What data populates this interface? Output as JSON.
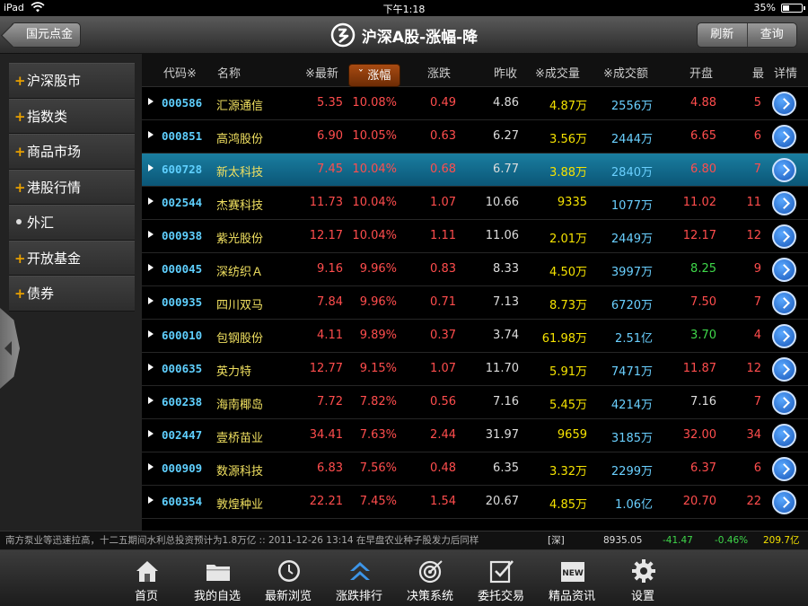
{
  "status": {
    "device": "iPad",
    "time": "下午1:18",
    "battery": "35%"
  },
  "header": {
    "back_label": "国元点金",
    "title": "沪深A股-涨幅-降",
    "refresh_label": "刷新",
    "query_label": "查询"
  },
  "sidebar": {
    "items": [
      {
        "label": "沪深股市",
        "marker": "+"
      },
      {
        "label": "指数类",
        "marker": "+"
      },
      {
        "label": "商品市场",
        "marker": "+"
      },
      {
        "label": "港股行情",
        "marker": "+"
      },
      {
        "label": "外汇",
        "marker": "•"
      },
      {
        "label": "开放基金",
        "marker": "+"
      },
      {
        "label": "债券",
        "marker": "+"
      }
    ]
  },
  "table": {
    "headers": {
      "code": "代码※",
      "name": "名称",
      "price": "※最新",
      "pct": "涨幅",
      "chg": "涨跌",
      "prev": "昨收",
      "vol": "※成交量",
      "amt": "※成交额",
      "open": "开盘",
      "high": "最",
      "detail": "详情"
    },
    "rows": [
      {
        "code": "000586",
        "name": "汇源通信",
        "price": "5.35",
        "pct": "10.08%",
        "chg": "0.49",
        "prev": "4.86",
        "vol": "4.87万",
        "amt": "2556万",
        "open": "4.88",
        "open_color": "red",
        "high": "5"
      },
      {
        "code": "000851",
        "name": "高鸿股份",
        "price": "6.90",
        "pct": "10.05%",
        "chg": "0.63",
        "prev": "6.27",
        "vol": "3.56万",
        "amt": "2444万",
        "open": "6.65",
        "open_color": "red",
        "high": "6"
      },
      {
        "code": "600728",
        "name": "新太科技",
        "price": "7.45",
        "pct": "10.04%",
        "chg": "0.68",
        "prev": "6.77",
        "vol": "3.88万",
        "amt": "2840万",
        "open": "6.80",
        "open_color": "red",
        "high": "7"
      },
      {
        "code": "002544",
        "name": "杰赛科技",
        "price": "11.73",
        "pct": "10.04%",
        "chg": "1.07",
        "prev": "10.66",
        "vol": "9335",
        "amt": "1077万",
        "open": "11.02",
        "open_color": "red",
        "high": "11"
      },
      {
        "code": "000938",
        "name": "紫光股份",
        "price": "12.17",
        "pct": "10.04%",
        "chg": "1.11",
        "prev": "11.06",
        "vol": "2.01万",
        "amt": "2449万",
        "open": "12.17",
        "open_color": "red",
        "high": "12"
      },
      {
        "code": "000045",
        "name": "深纺织Ａ",
        "price": "9.16",
        "pct": "9.96%",
        "chg": "0.83",
        "prev": "8.33",
        "vol": "4.50万",
        "amt": "3997万",
        "open": "8.25",
        "open_color": "green",
        "high": "9"
      },
      {
        "code": "000935",
        "name": "四川双马",
        "price": "7.84",
        "pct": "9.96%",
        "chg": "0.71",
        "prev": "7.13",
        "vol": "8.73万",
        "amt": "6720万",
        "open": "7.50",
        "open_color": "red",
        "high": "7"
      },
      {
        "code": "600010",
        "name": "包钢股份",
        "price": "4.11",
        "pct": "9.89%",
        "chg": "0.37",
        "prev": "3.74",
        "vol": "61.98万",
        "amt": "2.51亿",
        "open": "3.70",
        "open_color": "green",
        "high": "4"
      },
      {
        "code": "000635",
        "name": "英力特",
        "price": "12.77",
        "pct": "9.15%",
        "chg": "1.07",
        "prev": "11.70",
        "vol": "5.91万",
        "amt": "7471万",
        "open": "11.87",
        "open_color": "red",
        "high": "12"
      },
      {
        "code": "600238",
        "name": "海南椰岛",
        "price": "7.72",
        "pct": "7.82%",
        "chg": "0.56",
        "prev": "7.16",
        "vol": "5.45万",
        "amt": "4214万",
        "open": "7.16",
        "open_color": "white",
        "high": "7"
      },
      {
        "code": "002447",
        "name": "壹桥苗业",
        "price": "34.41",
        "pct": "7.63%",
        "chg": "2.44",
        "prev": "31.97",
        "vol": "9659",
        "amt": "3185万",
        "open": "32.00",
        "open_color": "red",
        "high": "34"
      },
      {
        "code": "000909",
        "name": "数源科技",
        "price": "6.83",
        "pct": "7.56%",
        "chg": "0.48",
        "prev": "6.35",
        "vol": "3.32万",
        "amt": "2299万",
        "open": "6.37",
        "open_color": "red",
        "high": "6"
      },
      {
        "code": "600354",
        "name": "敦煌种业",
        "price": "22.21",
        "pct": "7.45%",
        "chg": "1.54",
        "prev": "20.67",
        "vol": "4.85万",
        "amt": "1.06亿",
        "open": "20.70",
        "open_color": "red",
        "high": "22"
      }
    ],
    "selected_index": 2
  },
  "ticker": {
    "news": "南方泵业等迅速拉高，十二五期间水利总投资预计为1.8万亿 :: 2011-12-26 13:14 在早盘农业种子股发力后同样",
    "market": "[深]",
    "index": "8935.05",
    "change": "-41.47",
    "percent": "-0.46%",
    "amount": "209.7亿"
  },
  "tabbar": {
    "tabs": [
      {
        "label": "首页",
        "icon": "home-icon"
      },
      {
        "label": "我的自选",
        "icon": "folder-icon"
      },
      {
        "label": "最新浏览",
        "icon": "clock-icon"
      },
      {
        "label": "涨跌排行",
        "icon": "double-chevron-up-icon"
      },
      {
        "label": "决策系统",
        "icon": "target-icon"
      },
      {
        "label": "委托交易",
        "icon": "checklist-icon"
      },
      {
        "label": "精品资讯",
        "icon": "new-badge-icon"
      },
      {
        "label": "设置",
        "icon": "gear-icon"
      }
    ],
    "active_index": 3
  },
  "colors": {
    "accent": "#1a7ea0",
    "up": "#ff4d4d",
    "down": "#3fd84a",
    "volume": "#f5e200",
    "amount": "#6ad0ff",
    "code": "#5fd0ff",
    "name": "#f0e060",
    "sort_button": "#a84b12"
  }
}
